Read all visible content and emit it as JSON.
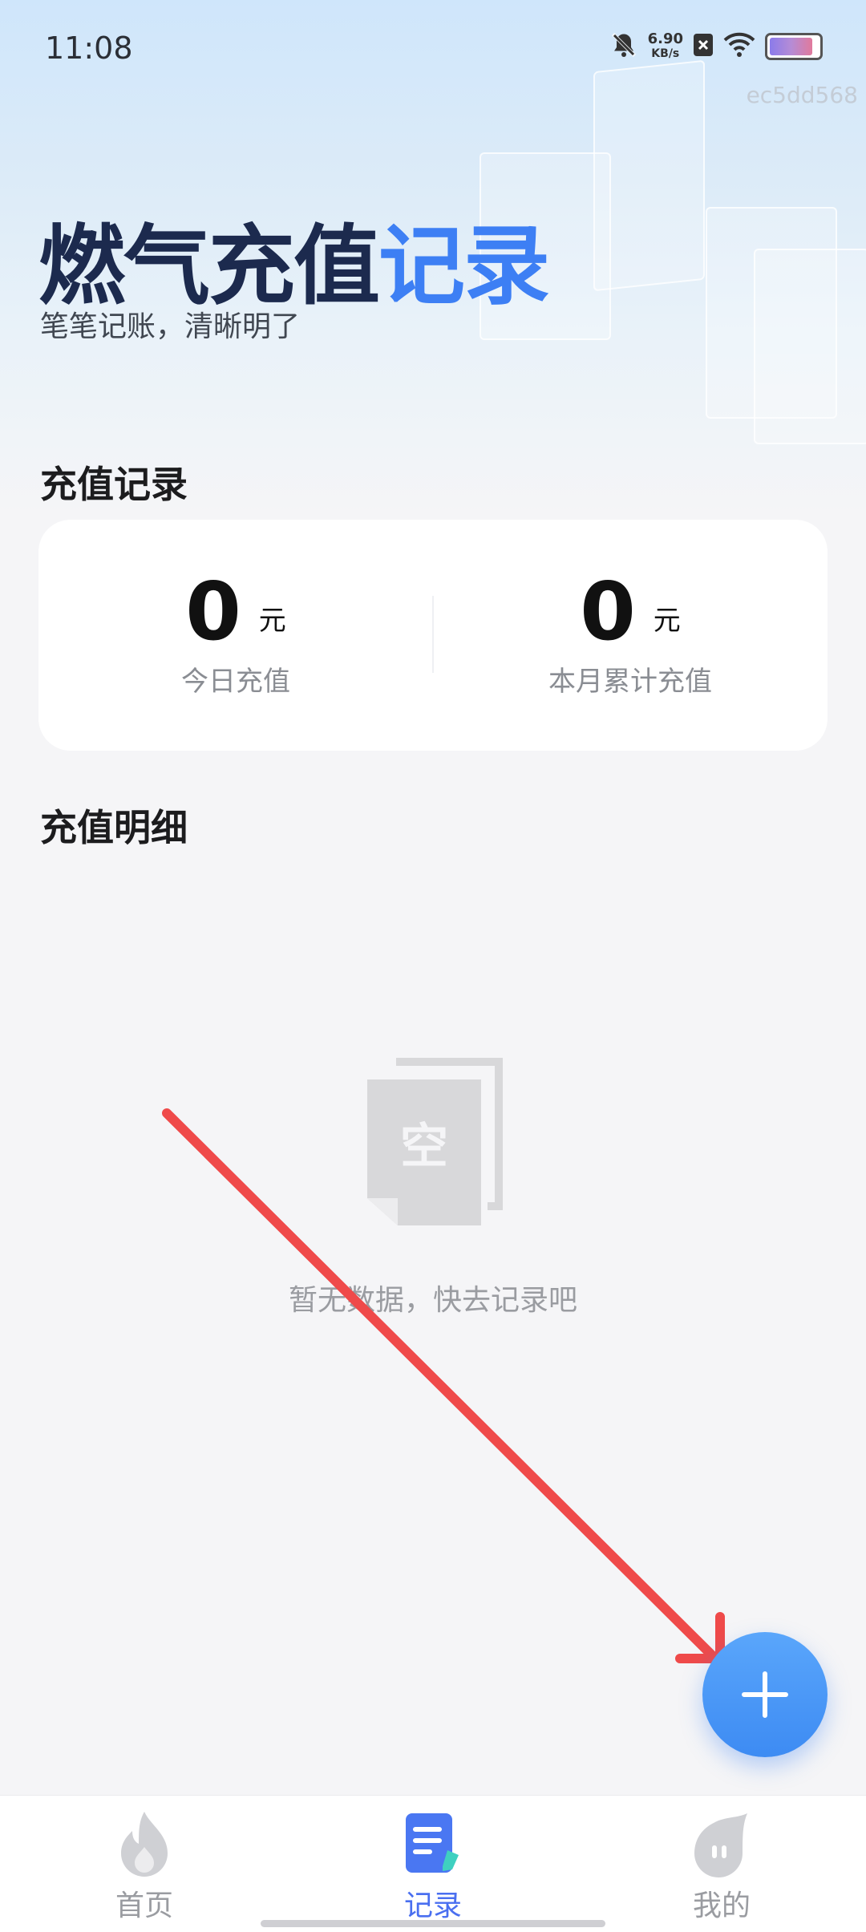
{
  "status_bar": {
    "time": "11:08",
    "net_speed_value": "6.90",
    "net_speed_unit": "KB/s",
    "battery_icon": "battery-icon"
  },
  "watermark": "ec5dd568",
  "hero": {
    "title_main": "燃气充值",
    "title_accent": "记录",
    "subtitle": "笔笔记账，清晰明了"
  },
  "summary": {
    "section_title": "充值记录",
    "today": {
      "value": "0",
      "unit": "元",
      "label": "今日充值"
    },
    "month": {
      "value": "0",
      "unit": "元",
      "label": "本月累计充值"
    }
  },
  "details": {
    "section_title": "充值明细",
    "empty_icon_text": "空",
    "empty_text": "暂无数据，快去记录吧"
  },
  "fab": {
    "icon": "plus-icon"
  },
  "tabs": [
    {
      "label": "首页",
      "icon": "flame-icon",
      "active": false
    },
    {
      "label": "记录",
      "icon": "record-icon",
      "active": true
    },
    {
      "label": "我的",
      "icon": "profile-icon",
      "active": false
    }
  ],
  "colors": {
    "accent": "#3d7ff4",
    "title_dark": "#1c2a4e",
    "fab": "#4a95f7",
    "tab_active": "#4a6ff0",
    "annotation_arrow": "#ef4a4a"
  }
}
